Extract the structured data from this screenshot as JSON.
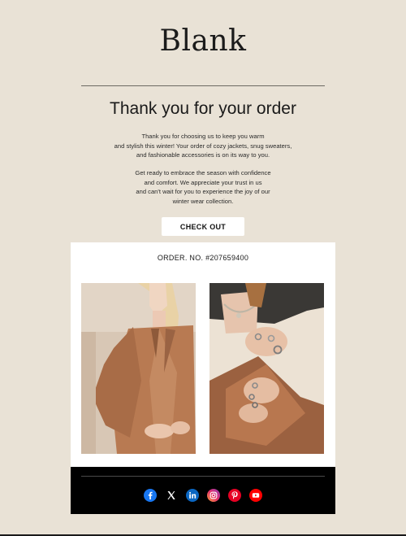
{
  "brand": {
    "logo_text": "Blank"
  },
  "header": {
    "title": "Thank you for your order"
  },
  "intro": {
    "paragraph_1": [
      "Thank you for choosing us to keep you warm",
      "and stylish this winter! Your order of cozy jackets, snug sweaters,",
      "and fashionable accessories is on its way to you."
    ],
    "paragraph_2": [
      "Get ready to embrace the season with confidence",
      "and comfort. We appreciate your trust in us",
      "and can't wait for you to experience the joy of our",
      "winter wear collection."
    ]
  },
  "cta": {
    "label": "CHECK OUT"
  },
  "order": {
    "number_label": "ORDER. NO. #207659400"
  },
  "products": [
    {
      "icon": "camel-blazer-photo"
    },
    {
      "icon": "rings-jewelry-photo"
    }
  ],
  "footer": {
    "social_icons": [
      "facebook-icon",
      "x-icon",
      "linkedin-icon",
      "instagram-icon",
      "pinterest-icon",
      "youtube-icon"
    ]
  },
  "colors": {
    "background": "#e9e2d6",
    "card": "#ffffff",
    "footer": "#000000",
    "facebook": "#1877f2",
    "linkedin": "#0a66c2",
    "pinterest": "#e60023",
    "youtube": "#ff0000"
  }
}
